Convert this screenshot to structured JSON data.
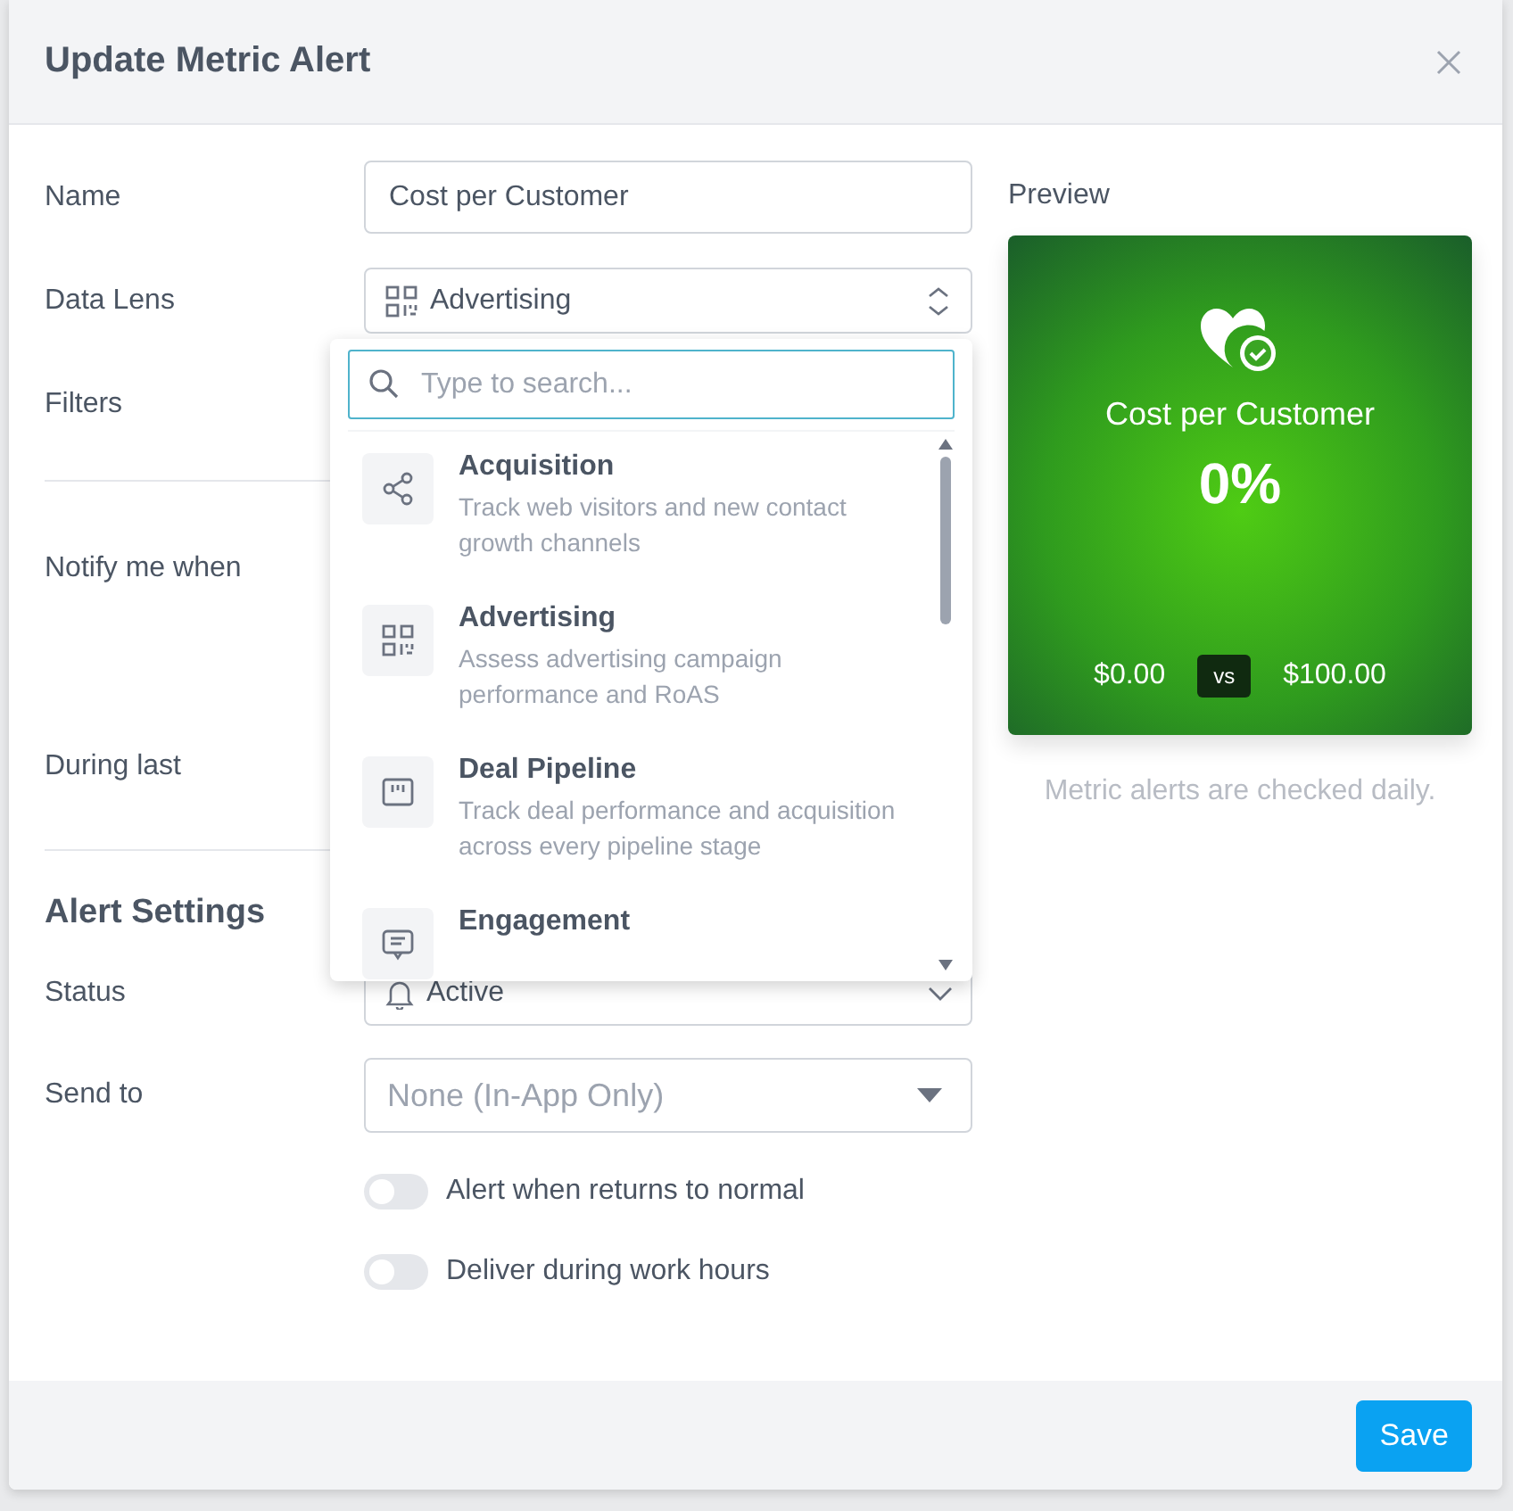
{
  "dialog": {
    "title": "Update Metric Alert"
  },
  "form": {
    "name": {
      "label": "Name",
      "value": "Cost per Customer"
    },
    "data_lens": {
      "label": "Data Lens",
      "value": "Advertising"
    },
    "filters": {
      "label": "Filters"
    },
    "notify": {
      "label": "Notify me when"
    },
    "during": {
      "label": "During last"
    },
    "section_title": "Alert Settings",
    "status": {
      "label": "Status",
      "value": "Active"
    },
    "send_to": {
      "label": "Send to",
      "placeholder": "None (In-App Only)"
    },
    "toggles": [
      {
        "label": "Alert when returns to normal",
        "on": false
      },
      {
        "label": "Deliver during work hours",
        "on": false
      }
    ]
  },
  "lens_dropdown": {
    "search_placeholder": "Type to search...",
    "options": [
      {
        "kind": "share",
        "title": "Acquisition",
        "description": "Track web visitors and new contact growth channels"
      },
      {
        "kind": "qr",
        "title": "Advertising",
        "description": "Assess advertising campaign performance and RoAS"
      },
      {
        "kind": "board",
        "title": "Deal Pipeline",
        "description": "Track deal performance and acquisition across every pipeline stage"
      },
      {
        "kind": "chat",
        "title": "Engagement"
      }
    ]
  },
  "preview": {
    "label": "Preview",
    "title": "Cost per Customer",
    "value": "0%",
    "current": "$0.00",
    "vs": "vs",
    "target": "$100.00",
    "note": "Metric alerts are checked daily."
  },
  "footer": {
    "save": "Save"
  }
}
